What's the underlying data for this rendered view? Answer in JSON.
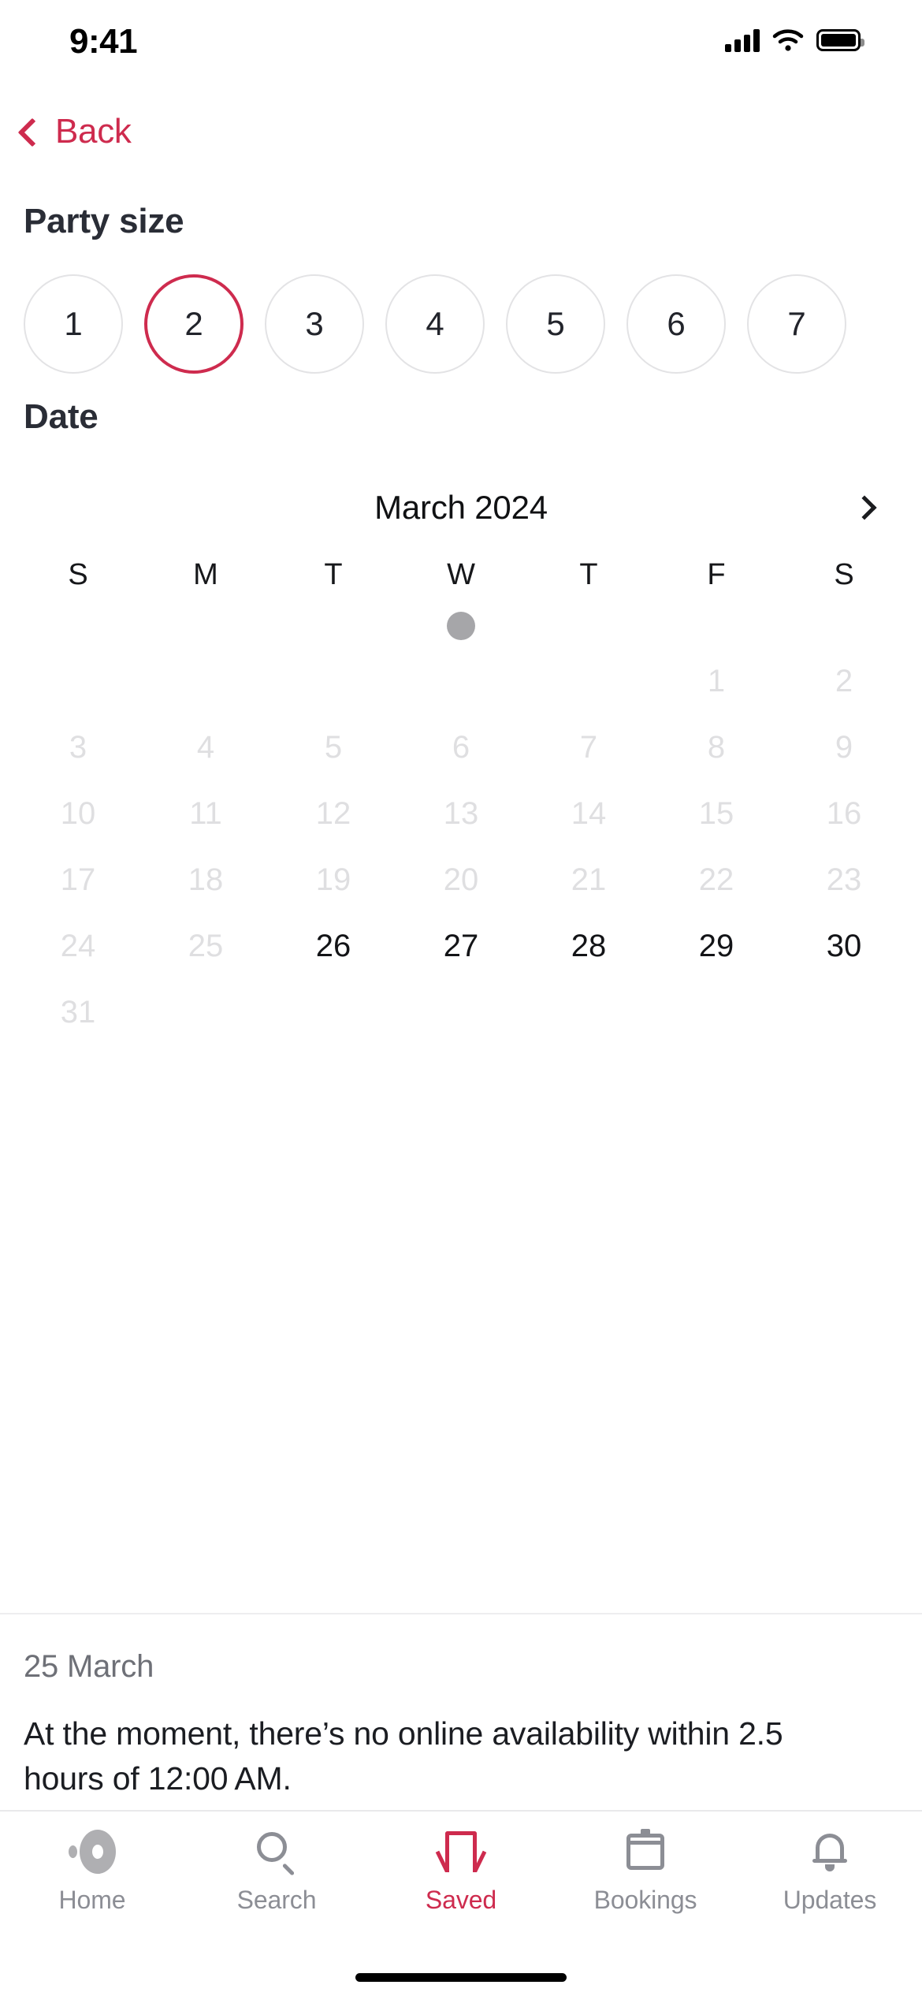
{
  "status_bar": {
    "time": "9:41",
    "signal_icon": "cellular-signal-icon",
    "wifi_icon": "wifi-icon",
    "battery_icon": "battery-icon"
  },
  "nav": {
    "back_label": "Back",
    "back_icon": "chevron-left-icon",
    "accent_color": "#CE2B4E"
  },
  "party_size": {
    "heading": "Party size",
    "options": [
      "1",
      "2",
      "3",
      "4",
      "5",
      "6",
      "7"
    ],
    "selected": "2"
  },
  "date": {
    "heading": "Date",
    "month_label": "March 2024",
    "next_month_icon": "chevron-right-icon",
    "weekdays": [
      "S",
      "M",
      "T",
      "W",
      "T",
      "F",
      "S"
    ],
    "loading_dot_column": 3,
    "leading_blanks": 5,
    "days": [
      {
        "n": "1",
        "enabled": false
      },
      {
        "n": "2",
        "enabled": false
      },
      {
        "n": "3",
        "enabled": false
      },
      {
        "n": "4",
        "enabled": false
      },
      {
        "n": "5",
        "enabled": false
      },
      {
        "n": "6",
        "enabled": false
      },
      {
        "n": "7",
        "enabled": false
      },
      {
        "n": "8",
        "enabled": false
      },
      {
        "n": "9",
        "enabled": false
      },
      {
        "n": "10",
        "enabled": false
      },
      {
        "n": "11",
        "enabled": false
      },
      {
        "n": "12",
        "enabled": false
      },
      {
        "n": "13",
        "enabled": false
      },
      {
        "n": "14",
        "enabled": false
      },
      {
        "n": "15",
        "enabled": false
      },
      {
        "n": "16",
        "enabled": false
      },
      {
        "n": "17",
        "enabled": false
      },
      {
        "n": "18",
        "enabled": false
      },
      {
        "n": "19",
        "enabled": false
      },
      {
        "n": "20",
        "enabled": false
      },
      {
        "n": "21",
        "enabled": false
      },
      {
        "n": "22",
        "enabled": false
      },
      {
        "n": "23",
        "enabled": false
      },
      {
        "n": "24",
        "enabled": false
      },
      {
        "n": "25",
        "enabled": false
      },
      {
        "n": "26",
        "enabled": true
      },
      {
        "n": "27",
        "enabled": true
      },
      {
        "n": "28",
        "enabled": true
      },
      {
        "n": "29",
        "enabled": true
      },
      {
        "n": "30",
        "enabled": true
      },
      {
        "n": "31",
        "enabled": false
      }
    ]
  },
  "availability": {
    "date_label": "25 March",
    "message": "At the moment, there’s no online availability within 2.5 hours of 12:00 AM."
  },
  "tab_bar": {
    "items": [
      {
        "label": "Home",
        "icon": "dining-plate-icon",
        "active": false
      },
      {
        "label": "Search",
        "icon": "search-icon",
        "active": false
      },
      {
        "label": "Saved",
        "icon": "bookmark-icon",
        "active": true
      },
      {
        "label": "Bookings",
        "icon": "calendar-icon",
        "active": false
      },
      {
        "label": "Updates",
        "icon": "bell-icon",
        "active": false
      }
    ]
  }
}
